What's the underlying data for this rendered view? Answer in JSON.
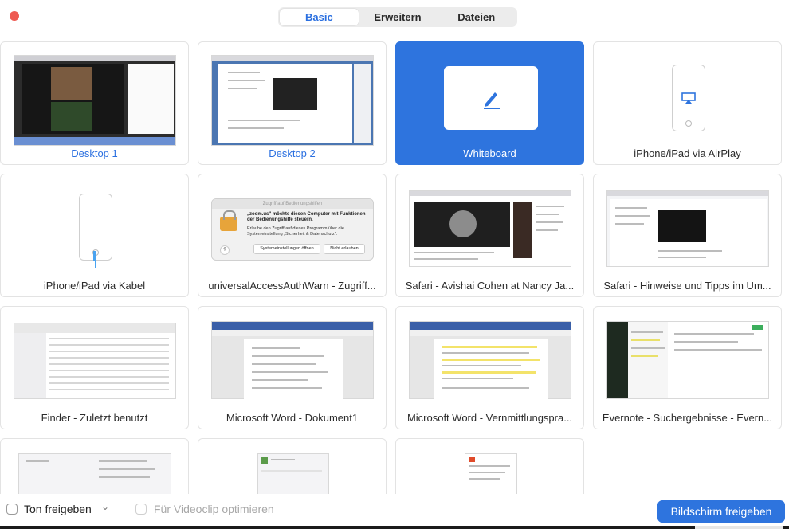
{
  "tabs": [
    {
      "label": "Basic",
      "active": true
    },
    {
      "label": "Erweitern",
      "active": false
    },
    {
      "label": "Dateien",
      "active": false
    }
  ],
  "tiles": [
    {
      "label": "Desktop 1"
    },
    {
      "label": "Desktop 2"
    },
    {
      "label": "Whiteboard"
    },
    {
      "label": "iPhone/iPad via AirPlay"
    },
    {
      "label": "iPhone/iPad via Kabel"
    },
    {
      "label": "universalAccessAuthWarn - Zugriff..."
    },
    {
      "label": "Safari - Avishai Cohen at Nancy Ja..."
    },
    {
      "label": "Safari - Hinweise und Tipps im Um..."
    },
    {
      "label": "Finder - Zuletzt benutzt"
    },
    {
      "label": "Microsoft Word - Dokument1"
    },
    {
      "label": "Microsoft Word - Vernmittlungspra..."
    },
    {
      "label": "Evernote - Suchergebnisse - Evern..."
    }
  ],
  "dialog": {
    "title": "Zugriff auf Bedienungshilfen",
    "heading": "„zoom.us\" möchte diesen Computer mit Funktionen der Bedienungshilfe steuern.",
    "body": "Erlaube den Zugriff auf dieses Programm über die Systemeinstellung „Sicherheit & Datenschutz\".",
    "btn_open": "Systemeinstellungen öffnen",
    "btn_deny": "Nicht erlauben",
    "help": "?"
  },
  "bottom": {
    "share_sound": "Ton freigeben",
    "chevron": "⌄",
    "optimize_video": "Für Videoclip optimieren",
    "share_button": "Bildschirm freigeben"
  },
  "colors": {
    "accent": "#2e74de",
    "close": "#ee5a52"
  }
}
